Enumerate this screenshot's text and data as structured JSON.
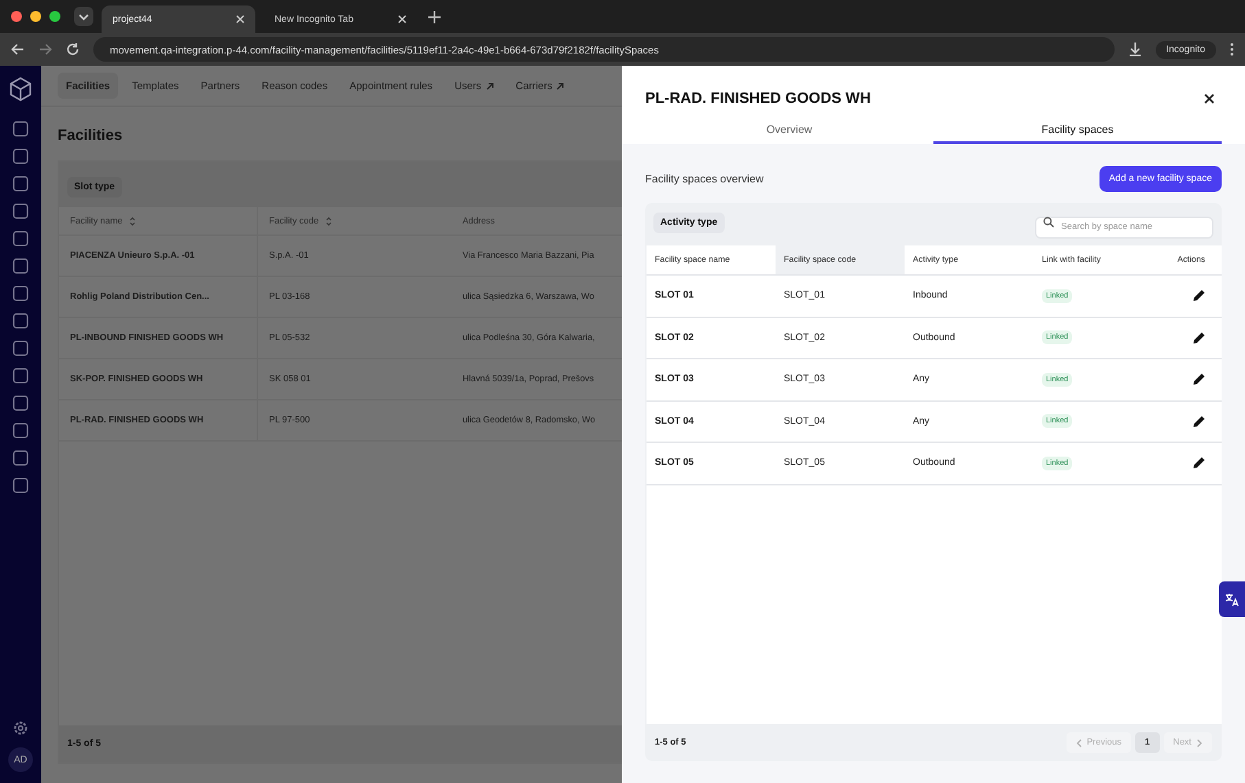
{
  "browser": {
    "tabs": [
      {
        "title": "project44",
        "selected": true
      },
      {
        "title": "New Incognito Tab",
        "selected": false
      }
    ],
    "url": "movement.qa-integration.p-44.com/facility-management/facilities/5119ef11-2a4c-49e1-b664-673d79f2182f/facilitySpaces",
    "profile": "Incognito"
  },
  "app_sidebar": {
    "avatar": "AD"
  },
  "nav_tabs": [
    {
      "label": "Facilities",
      "selected": true,
      "external": false
    },
    {
      "label": "Templates",
      "selected": false,
      "external": false
    },
    {
      "label": "Partners",
      "selected": false,
      "external": false
    },
    {
      "label": "Reason codes",
      "selected": false,
      "external": false
    },
    {
      "label": "Appointment rules",
      "selected": false,
      "external": false
    },
    {
      "label": "Users",
      "selected": false,
      "external": true
    },
    {
      "label": "Carriers",
      "selected": false,
      "external": true
    }
  ],
  "page": {
    "title": "Facilities",
    "filter": "Slot type",
    "columns": [
      {
        "label": "Facility name",
        "sortable": true
      },
      {
        "label": "Facility code",
        "sortable": true
      },
      {
        "label": "Address",
        "sortable": false
      }
    ],
    "rows": [
      [
        "PIACENZA Unieuro S.p.A. -01",
        "S.p.A. -01",
        "Via Francesco Maria Bazzani, Pia"
      ],
      [
        "Rohlig Poland Distribution Cen...",
        "PL 03-168",
        "ulica Sąsiedzka 6, Warszawa, Wo"
      ],
      [
        "PL-INBOUND FINISHED GOODS WH",
        "PL 05-532",
        "ulica Podleśna 30, Góra Kalwaria,"
      ],
      [
        "SK-POP. FINISHED GOODS WH",
        "SK 058 01",
        "Hlavná 5039/1a, Poprad, Prešovs"
      ],
      [
        "PL-RAD. FINISHED GOODS WH",
        "PL 97-500",
        "ulica Geodetów 8, Radomsko, Wo"
      ]
    ],
    "footer": "1-5 of 5"
  },
  "drawer": {
    "title": "PL-RAD. FINISHED GOODS WH",
    "tabs": [
      {
        "label": "Overview",
        "selected": false
      },
      {
        "label": "Facility spaces",
        "selected": true
      }
    ],
    "section_title": "Facility spaces overview",
    "add_button": "Add a new facility space",
    "filter": "Activity type",
    "search": {
      "placeholder": "Search by space name"
    },
    "columns": [
      {
        "label": "Facility space name",
        "highlighted": false
      },
      {
        "label": "Facility space code",
        "highlighted": true
      },
      {
        "label": "Activity type",
        "highlighted": false
      },
      {
        "label": "Link with facility",
        "highlighted": false
      },
      {
        "label": "Actions",
        "highlighted": false
      }
    ],
    "rows": [
      {
        "name": "SLOT 01",
        "code": "SLOT_01",
        "activity": "Inbound",
        "link": "Linked"
      },
      {
        "name": "SLOT 02",
        "code": "SLOT_02",
        "activity": "Outbound",
        "link": "Linked"
      },
      {
        "name": "SLOT 03",
        "code": "SLOT_03",
        "activity": "Any",
        "link": "Linked"
      },
      {
        "name": "SLOT 04",
        "code": "SLOT_04",
        "activity": "Any",
        "link": "Linked"
      },
      {
        "name": "SLOT 05",
        "code": "SLOT_05",
        "activity": "Outbound",
        "link": "Linked"
      }
    ],
    "footer": "1-5 of 5",
    "pagination": {
      "previous": "Previous",
      "previous_disabled": true,
      "page": "1",
      "next": "Next",
      "next_disabled": true
    }
  }
}
